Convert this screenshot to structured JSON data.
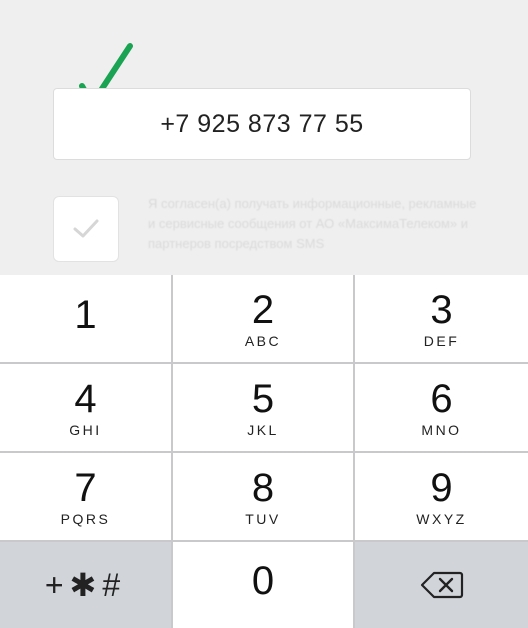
{
  "form": {
    "phone_value": "+7 925 873 77 55",
    "consent_text": "Я согласен(а) получать информационные, рекламные и сервисные сообщения от АО «МаксимаТелеком» и партнеров посредством SMS",
    "check_color": "#1aa352"
  },
  "keypad": {
    "keys": [
      {
        "digit": "1",
        "letters": ""
      },
      {
        "digit": "2",
        "letters": "ABC"
      },
      {
        "digit": "3",
        "letters": "DEF"
      },
      {
        "digit": "4",
        "letters": "GHI"
      },
      {
        "digit": "5",
        "letters": "JKL"
      },
      {
        "digit": "6",
        "letters": "MNO"
      },
      {
        "digit": "7",
        "letters": "PQRS"
      },
      {
        "digit": "8",
        "letters": "TUV"
      },
      {
        "digit": "9",
        "letters": "WXYZ"
      }
    ],
    "symbols_label": "+✱#",
    "zero": "0",
    "delete_icon": "backspace-icon"
  }
}
